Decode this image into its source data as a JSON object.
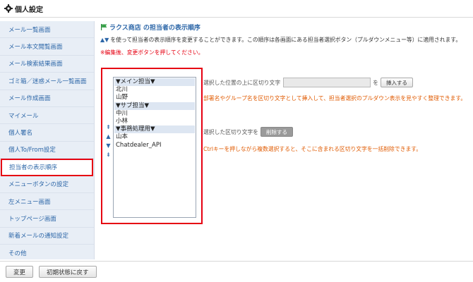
{
  "window": {
    "title": "個人設定"
  },
  "sidebar": {
    "items": [
      {
        "label": "メール一覧画面",
        "active": false
      },
      {
        "label": "メール本文閲覧画面",
        "active": false
      },
      {
        "label": "メール検索結果画面",
        "active": false
      },
      {
        "label": "ゴミ箱／迷惑メール一覧画面",
        "active": false
      },
      {
        "label": "メール作成画面",
        "active": false
      },
      {
        "label": "マイメール",
        "active": false
      },
      {
        "label": "個人署名",
        "active": false
      },
      {
        "label": "個人To/From設定",
        "active": false
      },
      {
        "label": "担当者の表示順序",
        "active": true
      },
      {
        "label": "メニューボタンの設定",
        "active": false
      },
      {
        "label": "左メニュー画面",
        "active": false
      },
      {
        "label": "トップページ画面",
        "active": false
      },
      {
        "label": "新着メールの通知設定",
        "active": false
      },
      {
        "label": "その他",
        "active": false
      }
    ]
  },
  "main": {
    "heading": "ラクス商店 の担当者の表示順序",
    "description_arrows": "▲▼",
    "description": "を使って担当者の表示順序を変更することができます。この順序は各画面にある担当者選択ボタン（プルダウンメニュー等）に適用されます。",
    "note": "※編集後、変更ボタンを押してください。",
    "move_buttons": [
      "⇞",
      "▲",
      "▼",
      "⇟"
    ],
    "list_items": [
      {
        "label": "▼メイン担当▼",
        "separator": true
      },
      {
        "label": "北川",
        "separator": false
      },
      {
        "label": "山野",
        "separator": false
      },
      {
        "label": "▼サブ担当▼",
        "separator": true
      },
      {
        "label": "中川",
        "separator": false
      },
      {
        "label": "小林",
        "separator": false
      },
      {
        "label": "▼事務処理用▼",
        "separator": true
      },
      {
        "label": "山本",
        "separator": false
      },
      {
        "label": "Chatdealer_API",
        "separator": false
      }
    ],
    "insert": {
      "label": "選択した位置の上に区切り文字",
      "value": "",
      "placeholder": "",
      "suffix": "を",
      "button": "挿入する",
      "info": "部署名やグループ名を区切り文字として挿入して、担当者選択のプルダウン表示を見やすく整理できます。"
    },
    "delete": {
      "label": "選択した区切り文字を",
      "button": "削除する",
      "info": "Ctrlキーを押しながら複数選択すると、そこに含まれる区切り文字を一括削除できます。"
    }
  },
  "footer": {
    "save_label": "変更",
    "reset_label": "初期状態に戻す"
  },
  "colors": {
    "accent": "#2d67a8",
    "highlight": "#e60012",
    "info": "#e05a00",
    "sidebar_bg": "#e8eef6"
  }
}
